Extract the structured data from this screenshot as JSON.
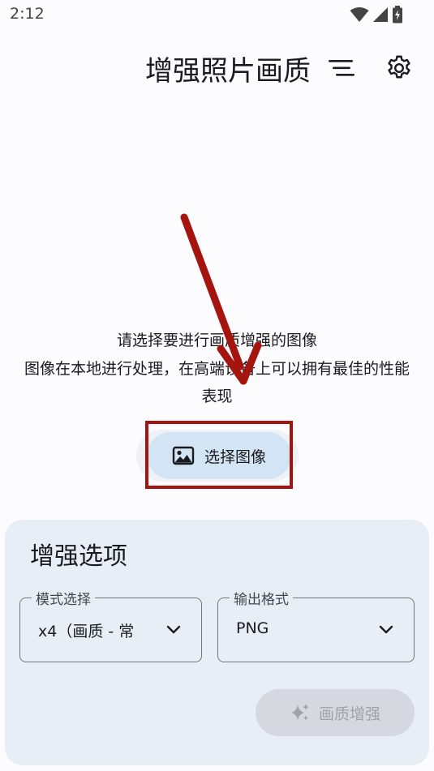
{
  "status_bar": {
    "time": "2:12",
    "icons": [
      "wifi-icon",
      "signal-icon",
      "battery-charging-icon"
    ]
  },
  "app_bar": {
    "title": "增强照片画质",
    "actions": [
      "sort-icon",
      "gear-icon"
    ]
  },
  "main": {
    "hint_line1": "请选择要进行画质增强的图像",
    "hint_line2": "图像在本地进行处理，在高端设备上可以拥有最佳的性能",
    "hint_line3": "表现",
    "select_button_label": "选择图像",
    "select_button_icon": "image-icon"
  },
  "annotation": {
    "color": "#a5140f"
  },
  "options": {
    "title": "增强选项",
    "mode_label": "模式选择",
    "mode_value": "x4（画质 - 常",
    "format_label": "输出格式",
    "format_value": "PNG",
    "enhance_label": "画质增强",
    "enhance_icon": "sparkle-icon"
  },
  "colors": {
    "accent_container": "#d3e4f4",
    "card_bg": "#e8eef6",
    "disabled_bg": "#d5d9df"
  }
}
